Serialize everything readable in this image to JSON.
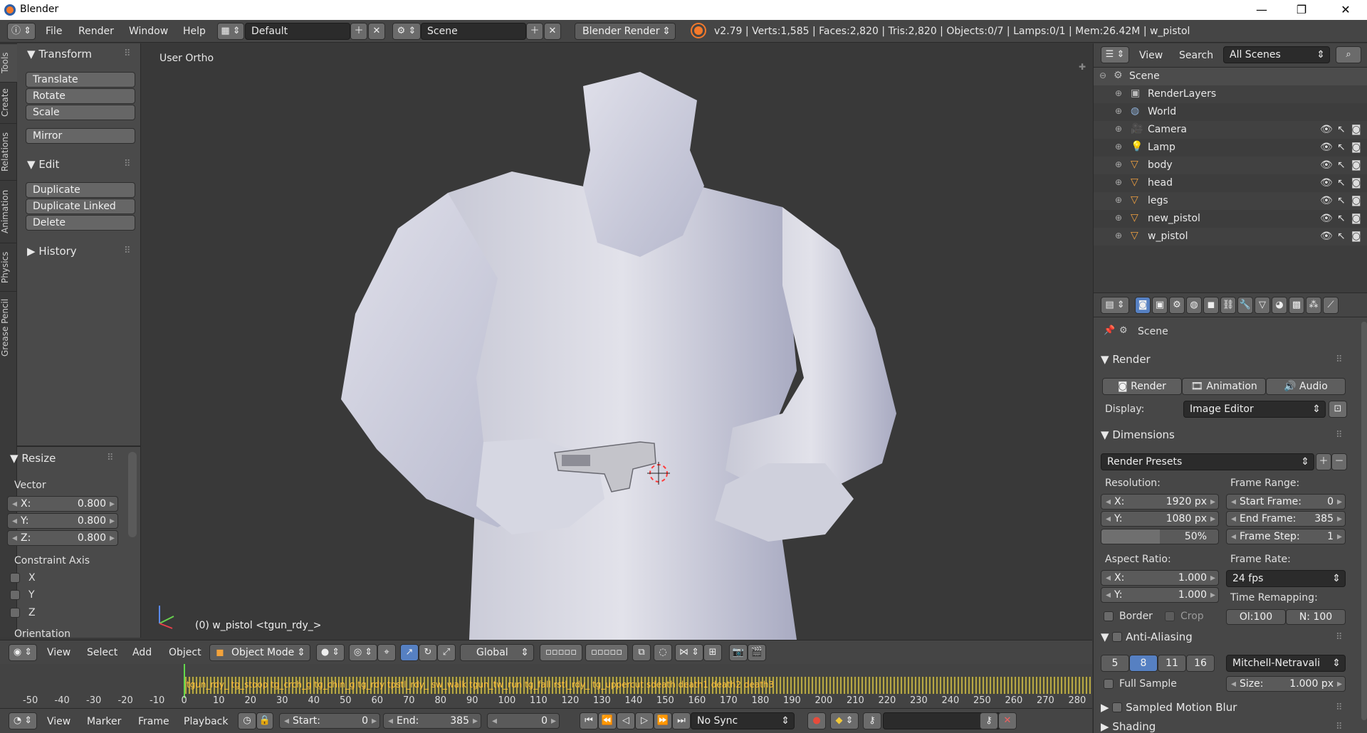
{
  "window": {
    "title": "Blender",
    "minimize": "—",
    "maximize": "❐",
    "close": "✕"
  },
  "menu": {
    "file": "File",
    "render": "Render",
    "window": "Window",
    "help": "Help"
  },
  "layout": {
    "value": "Default"
  },
  "scene": {
    "value": "Scene"
  },
  "engine": {
    "value": "Blender Render"
  },
  "stats": "v2.79 | Verts:1,585 | Faces:2,820 | Tris:2,820 | Objects:0/7 | Lamps:0/1 | Mem:26.42M | w_pistol",
  "tabs": [
    "Tools",
    "Create",
    "Relations",
    "Animation",
    "Physics",
    "Grease Pencil"
  ],
  "transform": {
    "title": "Transform",
    "translate": "Translate",
    "rotate": "Rotate",
    "scale": "Scale",
    "mirror": "Mirror"
  },
  "edit": {
    "title": "Edit",
    "duplicate": "Duplicate",
    "duplicate_linked": "Duplicate Linked",
    "delete": "Delete"
  },
  "history": {
    "title": "History"
  },
  "resize": {
    "title": "Resize",
    "vector_label": "Vector",
    "x_label": "X:",
    "x": "0.800",
    "y_label": "Y:",
    "y": "0.800",
    "z_label": "Z:",
    "z": "0.800",
    "constraint_label": "Constraint Axis",
    "cx": "X",
    "cy": "Y",
    "cz": "Z",
    "orientation_label": "Orientation"
  },
  "viewport": {
    "view_name": "User Ortho",
    "object_info": "(0) w_pistol <tgun_rdy_>"
  },
  "vphead": {
    "view": "View",
    "select": "Select",
    "add": "Add",
    "object": "Object",
    "mode": "Object Mode",
    "orientation": "Global"
  },
  "timeline": {
    "markers": "tgun_rdy_   tg_stoop  tg_crch_g  tg_chin_g  tg_rdy  tpstl_rdy_  sw_walk  tgun_tw_run  tg_fall  rstl_rdy_  tg_uppercut  sdeath  death1  death2  death3",
    "ruler": [
      "-50",
      "-40",
      "-30",
      "-20",
      "-10",
      "0",
      "10",
      "20",
      "30",
      "40",
      "50",
      "60",
      "70",
      "80",
      "90",
      "100",
      "110",
      "120",
      "130",
      "140",
      "150",
      "160",
      "170",
      "180",
      "190",
      "200",
      "210",
      "220",
      "230",
      "240",
      "250",
      "260",
      "270",
      "280"
    ]
  },
  "tlbar": {
    "view": "View",
    "marker": "Marker",
    "frame": "Frame",
    "playback": "Playback",
    "start_label": "Start:",
    "start": "0",
    "end_label": "End:",
    "end": "385",
    "current": "0",
    "sync": "No Sync"
  },
  "outliner": {
    "view": "View",
    "search": "Search",
    "filter": "All Scenes",
    "items": [
      {
        "name": "Scene",
        "level": 0
      },
      {
        "name": "RenderLayers",
        "level": 1
      },
      {
        "name": "World",
        "level": 1
      },
      {
        "name": "Camera",
        "level": 1
      },
      {
        "name": "Lamp",
        "level": 1
      },
      {
        "name": "body",
        "level": 1
      },
      {
        "name": "head",
        "level": 1
      },
      {
        "name": "legs",
        "level": 1
      },
      {
        "name": "new_pistol",
        "level": 1
      },
      {
        "name": "w_pistol",
        "level": 1
      }
    ]
  },
  "props": {
    "context": "Scene",
    "render_title": "Render",
    "render_btn": "Render",
    "animation_btn": "Animation",
    "audio_btn": "Audio",
    "display_label": "Display:",
    "display": "Image Editor",
    "dimensions_title": "Dimensions",
    "presets": "Render Presets",
    "resolution_label": "Resolution:",
    "res_x_label": "X:",
    "res_x": "1920 px",
    "res_y_label": "Y:",
    "res_y": "1080 px",
    "res_pct": "50%",
    "frame_range_label": "Frame Range:",
    "start_label": "Start Frame:",
    "start": "0",
    "end_label": "End Frame:",
    "end": "385",
    "step_label": "Frame Step:",
    "step": "1",
    "aspect_label": "Aspect Ratio:",
    "asp_x_label": "X:",
    "asp_x": "1.000",
    "asp_y_label": "Y:",
    "asp_y": "1.000",
    "frame_rate_label": "Frame Rate:",
    "frame_rate": "24 fps",
    "border": "Border",
    "crop": "Crop",
    "remap_label": "Time Remapping:",
    "remap_old": "Ol:100",
    "remap_new": "N: 100",
    "aa_title": "Anti-Aliasing",
    "aa_5": "5",
    "aa_8": "8",
    "aa_11": "11",
    "aa_16": "16",
    "aa_filter": "Mitchell-Netravali",
    "full_sample": "Full Sample",
    "size_label": "Size:",
    "size": "1.000 px",
    "motion_blur": "Sampled Motion Blur",
    "shading": "Shading"
  }
}
